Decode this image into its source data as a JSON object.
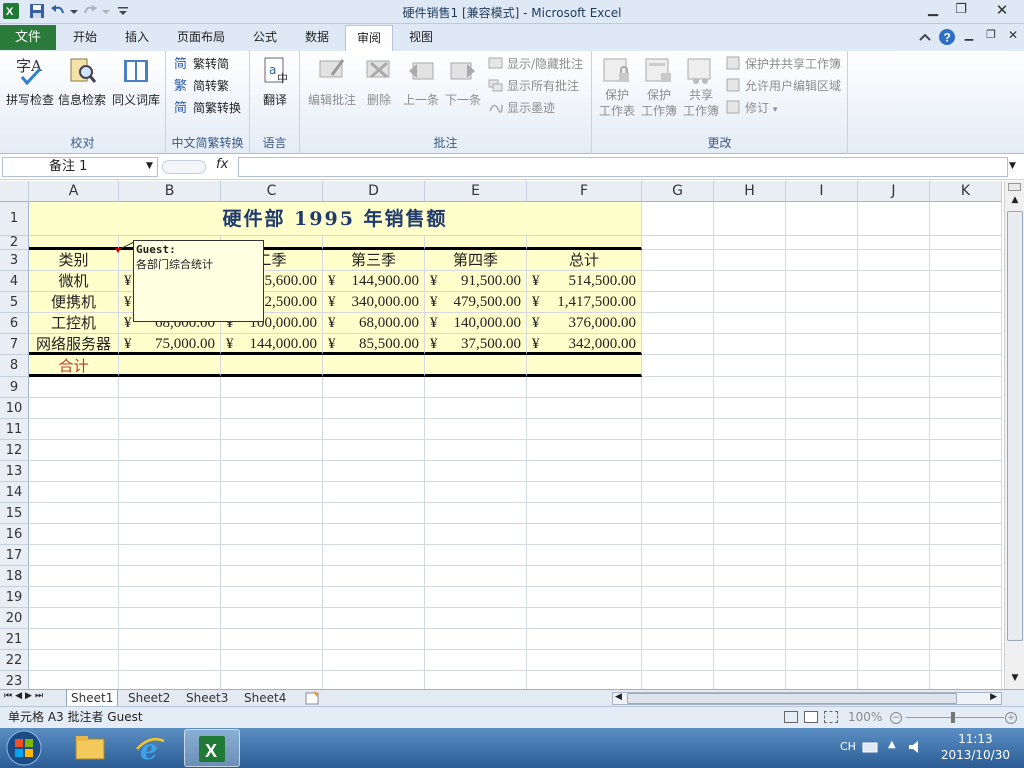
{
  "window": {
    "title": "硬件销售1  [兼容模式] - Microsoft Excel"
  },
  "tabs": [
    "开始",
    "插入",
    "页面布局",
    "公式",
    "数据",
    "审阅",
    "视图"
  ],
  "file_tab": "文件",
  "active_tab": "审阅",
  "ribbon": {
    "proofing": {
      "label": "校对",
      "buttons": [
        "拼写检查",
        "信息检索",
        "同义词库"
      ]
    },
    "chinese": {
      "label": "中文简繁转换",
      "buttons": [
        "繁转简",
        "简转繁",
        "简繁转换"
      ]
    },
    "language": {
      "label": "语言",
      "buttons": [
        "翻译"
      ]
    },
    "comments": {
      "label": "批注",
      "buttons": [
        "编辑批注",
        "删除",
        "上一条",
        "下一条"
      ],
      "small": [
        "显示/隐藏批注",
        "显示所有批注",
        "显示墨迹"
      ]
    },
    "changes": {
      "label": "更改",
      "buttons": [
        "保护\n工作表",
        "保护\n工作簿",
        "共享\n工作簿"
      ],
      "small": [
        "保护并共享工作簿",
        "允许用户编辑区域",
        "修订"
      ]
    }
  },
  "formula_bar": {
    "name_box": "备注 1",
    "fx": "fx"
  },
  "columns": [
    "A",
    "B",
    "C",
    "D",
    "E",
    "F",
    "G",
    "H",
    "I",
    "J",
    "K"
  ],
  "rows": [
    "1",
    "2",
    "3",
    "4",
    "5",
    "6",
    "7",
    "8",
    "9",
    "10",
    "11",
    "12",
    "13",
    "14",
    "15",
    "16",
    "17",
    "18",
    "19",
    "20",
    "21",
    "22",
    "23"
  ],
  "sheet": {
    "title": "硬件部 1995 年销售额",
    "headers": [
      "类别",
      "",
      "二季",
      "第三季",
      "第四季",
      "总计"
    ],
    "data_rows": [
      {
        "cat": "微机",
        "b": [
          "¥",
          ""
        ],
        "c": [
          "",
          "5,600.00"
        ],
        "d": [
          "¥",
          "144,900.00"
        ],
        "e": [
          "¥",
          "91,500.00"
        ],
        "f": [
          "¥",
          "514,500.00"
        ]
      },
      {
        "cat": "便携机",
        "b": [
          "¥",
          ""
        ],
        "c": [
          "",
          "2,500.00"
        ],
        "d": [
          "¥",
          "340,000.00"
        ],
        "e": [
          "¥",
          "479,500.00"
        ],
        "f": [
          "¥",
          "1,417,500.00"
        ]
      },
      {
        "cat": "工控机",
        "b": [
          "¥",
          "68,000.00"
        ],
        "c": [
          "¥",
          "100,000.00"
        ],
        "d": [
          "¥",
          "68,000.00"
        ],
        "e": [
          "¥",
          "140,000.00"
        ],
        "f": [
          "¥",
          "376,000.00"
        ]
      },
      {
        "cat": "网络服务器",
        "b": [
          "¥",
          "75,000.00"
        ],
        "c": [
          "¥",
          "144,000.00"
        ],
        "d": [
          "¥",
          "85,500.00"
        ],
        "e": [
          "¥",
          "37,500.00"
        ],
        "f": [
          "¥",
          "342,000.00"
        ]
      }
    ],
    "total_label": "合计"
  },
  "comment": {
    "author": "Guest:",
    "text": "各部门综合统计"
  },
  "sheet_tabs": [
    "Sheet1",
    "Sheet2",
    "Sheet3",
    "Sheet4"
  ],
  "status": {
    "text": "单元格 A3 批注者 Guest",
    "zoom": "100%"
  },
  "taskbar": {
    "lang": "CH",
    "time": "11:13",
    "date": "2013/10/30"
  }
}
